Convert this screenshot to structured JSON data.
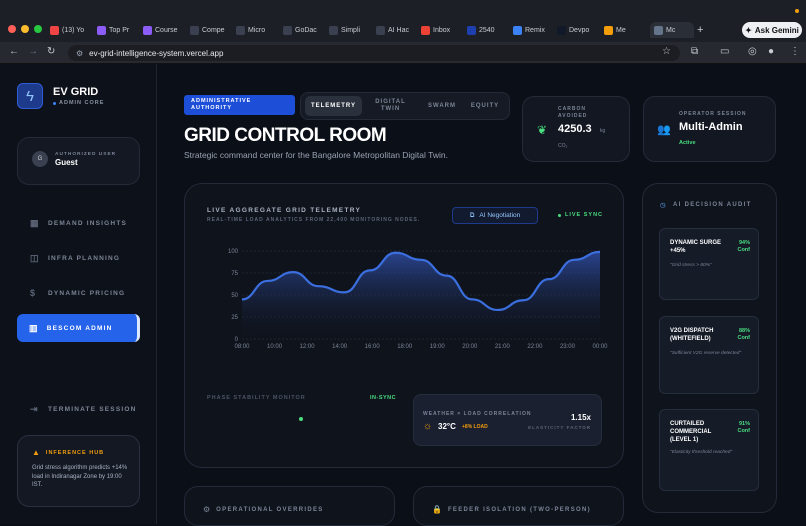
{
  "browser": {
    "tabs": [
      {
        "label": "(13) Yo",
        "icon": "youtube-icon",
        "color": "#ef4444"
      },
      {
        "label": "Top Pr",
        "icon": "app-icon",
        "color": "#8b5cf6"
      },
      {
        "label": "Course",
        "icon": "app-icon",
        "color": "#8b5cf6"
      },
      {
        "label": "Compe",
        "icon": "h-icon",
        "color": "#3a4050"
      },
      {
        "label": "Micro",
        "icon": "h-icon",
        "color": "#3a4050"
      },
      {
        "label": "GoDac",
        "icon": "h-icon",
        "color": "#3a4050"
      },
      {
        "label": "Simpli",
        "icon": "h-icon",
        "color": "#3a4050"
      },
      {
        "label": "AI Hac",
        "icon": "h-icon",
        "color": "#3a4050"
      },
      {
        "label": "Inbox",
        "icon": "gmail-icon",
        "color": "#ea4335"
      },
      {
        "label": "2540",
        "icon": "un-icon",
        "color": "#1e40af"
      },
      {
        "label": "Remix",
        "icon": "sparkle-icon",
        "color": "#3b82f6"
      },
      {
        "label": "Devpo",
        "icon": "d-icon",
        "color": "#111827"
      },
      {
        "label": "Me",
        "icon": "doc-icon",
        "color": "#f59e0b"
      },
      {
        "label": "Mc",
        "icon": "globe-icon",
        "color": "#64748b"
      }
    ],
    "new_tab": "+",
    "gemini_label": "Ask Gemini",
    "url": "ev-grid-intelligence-system.vercel.app"
  },
  "sidebar": {
    "brand": "EV GRID",
    "brand_sub": "ADMIN CORE",
    "user_label": "AUTHORIZED USER",
    "user_name": "Guest",
    "user_initial": "G",
    "items": [
      {
        "label": "DEMAND INSIGHTS",
        "icon": "grid-icon"
      },
      {
        "label": "INFRA PLANNING",
        "icon": "map-icon"
      },
      {
        "label": "DYNAMIC PRICING",
        "icon": "dollar-icon"
      },
      {
        "label": "BESCOM ADMIN",
        "icon": "building-icon"
      }
    ],
    "terminate": "TERMINATE SESSION",
    "hub_title": "INFERENCE HUB",
    "hub_text": "Grid stress algorithm predicts +14% load in Indiranagar Zone by 19:00 IST."
  },
  "header": {
    "badge": "ADMINISTRATIVE AUTHORITY",
    "tabs": [
      "TELEMETRY",
      "DIGITAL TWIN",
      "SWARM",
      "EQUITY"
    ],
    "title": "GRID CONTROL ROOM",
    "subtitle": "Strategic command center for the Bangalore Metropolitan Digital Twin."
  },
  "metrics": {
    "carbon_label": "CARBON AVOIDED",
    "carbon_value": "4250.3",
    "carbon_unit": "kg",
    "carbon_sub": "CO₂",
    "operator_label": "OPERATOR SESSION",
    "operator_value": "Multi-Admin",
    "operator_status": "Active"
  },
  "telemetry": {
    "title": "LIVE AGGREGATE GRID TELEMETRY",
    "subtitle": "REAL-TIME LOAD ANALYTICS FROM 22,400 MONITORING NODES.",
    "negotiation": "AI Negotiation",
    "live": "LIVE SYNC",
    "phase_label": "PHASE STABILITY MONITOR",
    "phase_status": "IN-SYNC",
    "corr_title": "WEATHER × LOAD CORRELATION",
    "corr_temp": "32°C",
    "corr_load": "+8% LOAD",
    "corr_factor": "1.15x",
    "corr_factor_label": "ELASTICITY FACTOR"
  },
  "chart_data": {
    "type": "area",
    "x": [
      "08:00",
      "10:00",
      "12:00",
      "14:00",
      "16:00",
      "18:00",
      "19:00",
      "20:00",
      "21:00",
      "22:00",
      "23:00",
      "00:00"
    ],
    "y": [
      45,
      66,
      76,
      60,
      53,
      78,
      98,
      90,
      72,
      45,
      33,
      44,
      68,
      90,
      99
    ],
    "ylim": [
      0,
      100
    ],
    "yticks": [
      "100",
      "75",
      "50",
      "25",
      "0"
    ],
    "grid": true,
    "color": "#3b6fe0"
  },
  "audit": {
    "title": "AI DECISION AUDIT",
    "items": [
      {
        "title": "DYNAMIC SURGE +45%",
        "conf": "94% Conf",
        "quote": "\"Grid stress > 80%\""
      },
      {
        "title": "V2G DISPATCH (WHITEFIELD)",
        "conf": "88% Conf",
        "quote": "\"Sufficient V2G reserve detected\""
      },
      {
        "title": "CURTAILED COMMERCIAL (LEVEL 1)",
        "conf": "91% Conf",
        "quote": "\"Elasticity threshold reached\""
      }
    ]
  },
  "bottom": {
    "overrides": "OPERATIONAL OVERRIDES",
    "isolation": "FEEDER ISOLATION (TWO-PERSON)"
  }
}
